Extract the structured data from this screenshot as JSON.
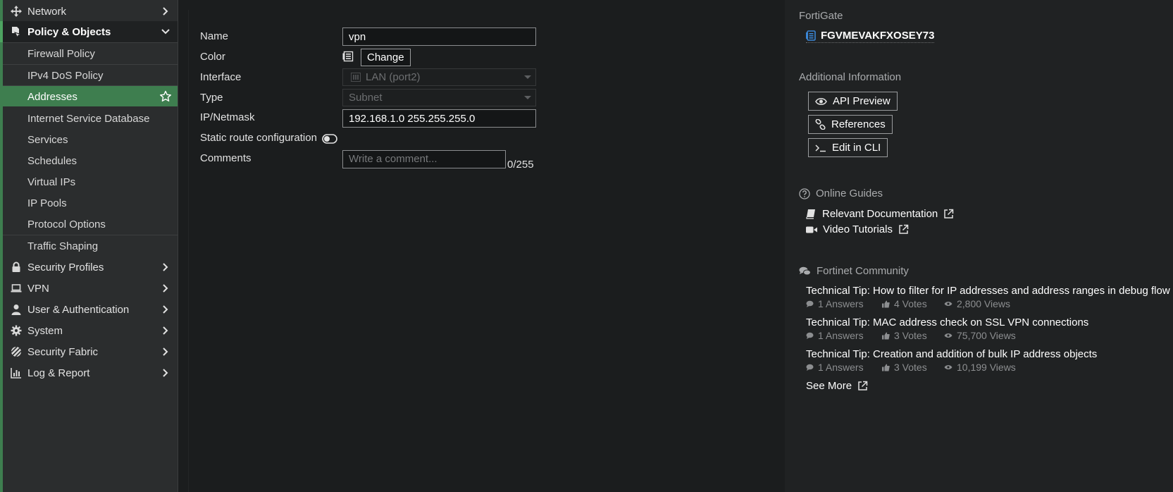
{
  "sidebar": {
    "network": "Network",
    "policy_objects": "Policy & Objects",
    "sub": {
      "firewall_policy": "Firewall Policy",
      "ipv4_dos": "IPv4 DoS Policy",
      "addresses": "Addresses",
      "isdb": "Internet Service Database",
      "services": "Services",
      "schedules": "Schedules",
      "virtual_ips": "Virtual IPs",
      "ip_pools": "IP Pools",
      "protocol_options": "Protocol Options",
      "traffic_shaping": "Traffic Shaping"
    },
    "security_profiles": "Security Profiles",
    "vpn": "VPN",
    "user_auth": "User & Authentication",
    "system": "System",
    "security_fabric": "Security Fabric",
    "log_report": "Log & Report"
  },
  "form": {
    "name_label": "Name",
    "name_value": "vpn",
    "color_label": "Color",
    "change_button": "Change",
    "interface_label": "Interface",
    "interface_value": "LAN (port2)",
    "type_label": "Type",
    "type_value": "Subnet",
    "ip_label": "IP/Netmask",
    "ip_value": "192.168.1.0 255.255.255.0",
    "static_route_label": "Static route configuration",
    "comments_label": "Comments",
    "comments_placeholder": "Write a comment...",
    "comments_count": "0/255"
  },
  "panel": {
    "fortigate_title": "FortiGate",
    "device_name": "FGVMEVAKFXOSEY73",
    "additional_title": "Additional Information",
    "api_preview": "API Preview",
    "references": "References",
    "edit_cli": "Edit in CLI",
    "guides_title": "Online Guides",
    "relevant_docs": "Relevant Documentation",
    "video_tutorials": "Video Tutorials",
    "community_title": "Fortinet Community",
    "topics": [
      {
        "title": "Technical Tip: How to filter for IP addresses and address ranges in debug flow",
        "answers": "1 Answers",
        "votes": "4 Votes",
        "views": "2,800 Views"
      },
      {
        "title": "Technical Tip: MAC address check on SSL VPN connections",
        "answers": "1 Answers",
        "votes": "3 Votes",
        "views": "75,700 Views"
      },
      {
        "title": "Technical Tip: Creation and addition of bulk IP address objects",
        "answers": "1 Answers",
        "votes": "3 Votes",
        "views": "10,199 Views"
      }
    ],
    "see_more": "See More"
  },
  "colors": {
    "accent_green": "#3e7e4f",
    "sidebar_bg": "#2b2d2e",
    "main_bg": "#1b1d1e",
    "panel_bg": "#202223",
    "device_icon_blue": "#3a86d6"
  }
}
